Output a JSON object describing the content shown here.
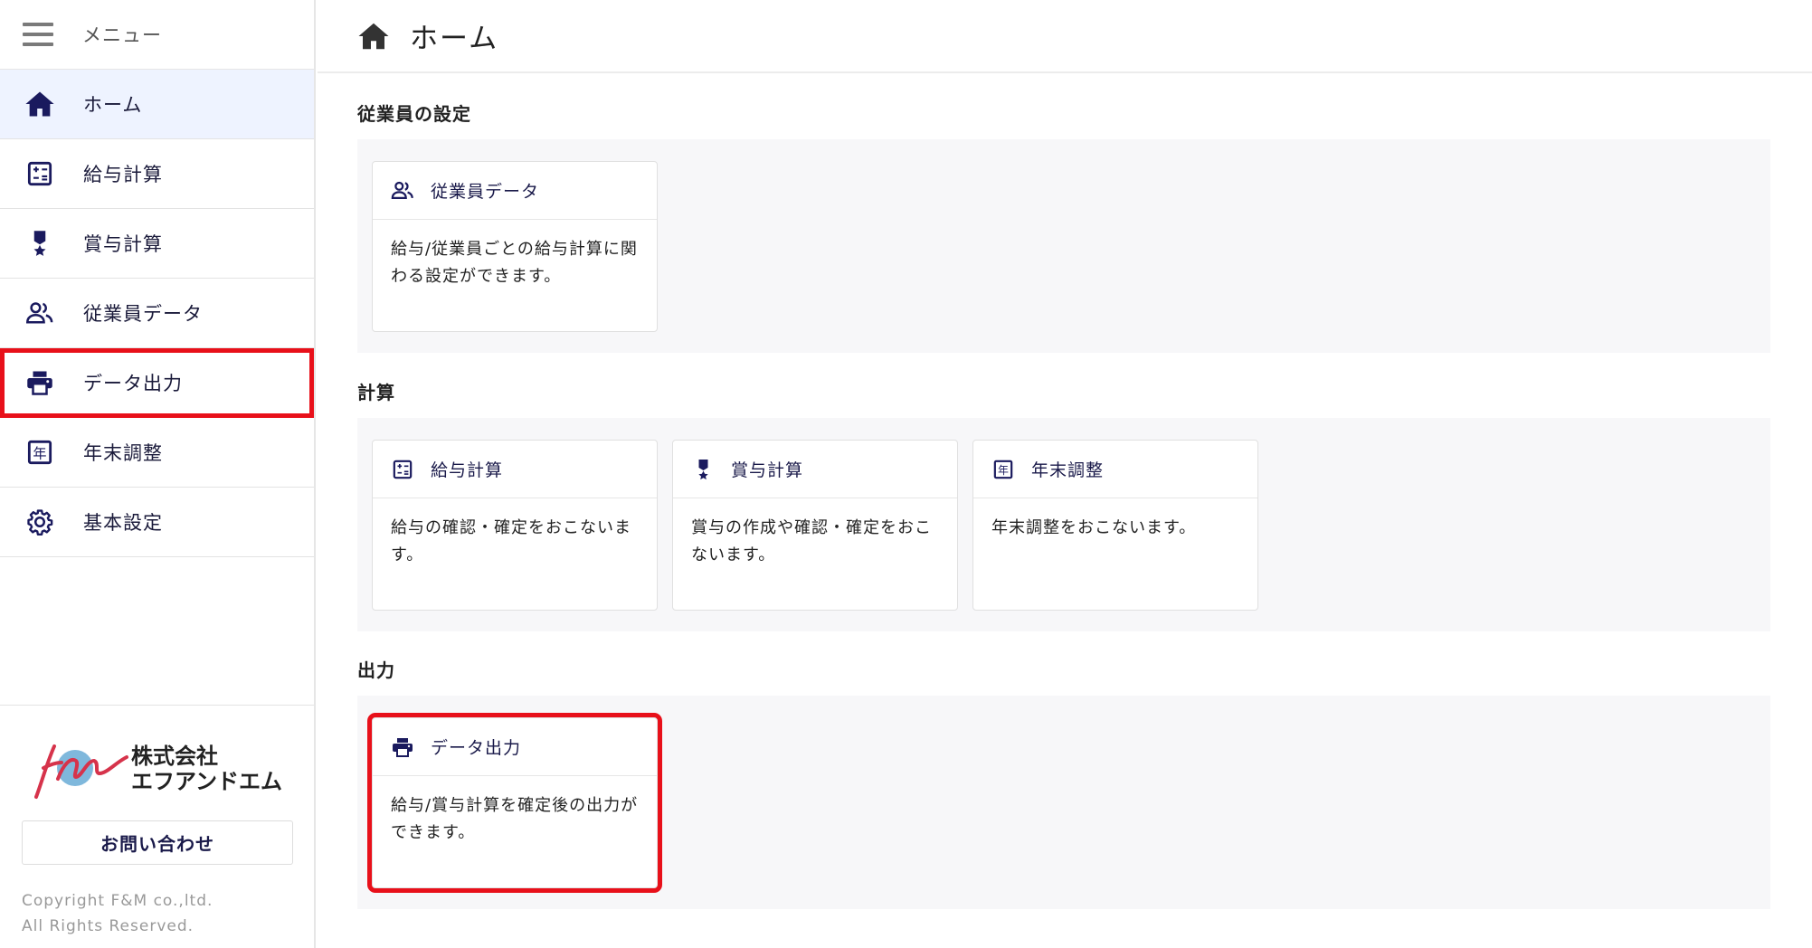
{
  "sidebar": {
    "menu_label": "メニュー",
    "items": [
      {
        "label": "ホーム",
        "icon": "home-icon",
        "active": true
      },
      {
        "label": "給与計算",
        "icon": "calculator-icon"
      },
      {
        "label": "賞与計算",
        "icon": "medal-icon"
      },
      {
        "label": "従業員データ",
        "icon": "people-icon"
      },
      {
        "label": "データ出力",
        "icon": "printer-icon",
        "highlighted": true
      },
      {
        "label": "年末調整",
        "icon": "year-icon"
      },
      {
        "label": "基本設定",
        "icon": "gear-icon"
      }
    ],
    "company_line1": "株式会社",
    "company_line2": "エフアンドエム",
    "contact_label": "お問い合わせ",
    "copyright_line1": "Copyright F&M co.,ltd.",
    "copyright_line2": "All Rights Reserved."
  },
  "header": {
    "title": "ホーム",
    "icon": "home-icon"
  },
  "sections": [
    {
      "title": "従業員の設定",
      "cards": [
        {
          "title": "従業員データ",
          "icon": "people-icon",
          "description": "給与/従業員ごとの給与計算に関わる設定ができます。"
        }
      ]
    },
    {
      "title": "計算",
      "cards": [
        {
          "title": "給与計算",
          "icon": "calculator-icon",
          "description": "給与の確認・確定をおこないます。"
        },
        {
          "title": "賞与計算",
          "icon": "medal-icon",
          "description": "賞与の作成や確認・確定をおこないます。"
        },
        {
          "title": "年末調整",
          "icon": "year-icon",
          "description": "年末調整をおこないます。"
        }
      ]
    },
    {
      "title": "出力",
      "cards": [
        {
          "title": "データ出力",
          "icon": "printer-icon",
          "description": "給与/賞与計算を確定後の出力ができます。",
          "highlighted": true
        }
      ]
    }
  ],
  "colors": {
    "accent_navy": "#1a1a5e",
    "highlight_red": "#e8101a",
    "active_bg": "#eef3ff",
    "section_bg": "#f7f7f9"
  }
}
